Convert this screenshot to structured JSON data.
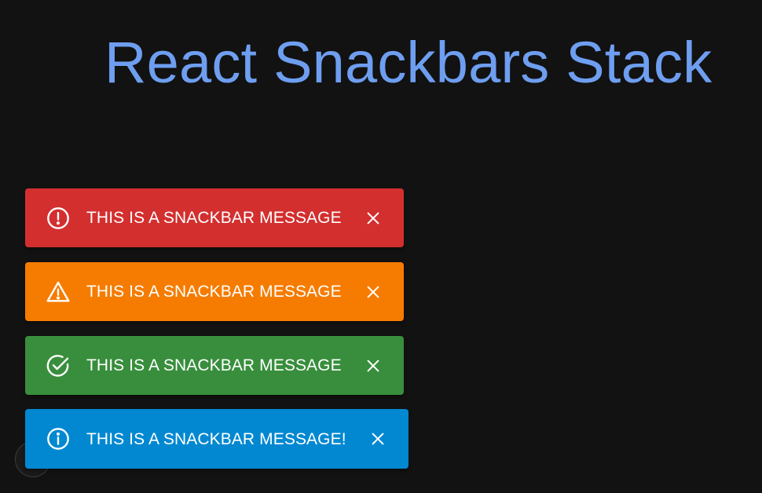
{
  "header": {
    "title": "React Snackbars Stack"
  },
  "colors": {
    "title": "#6e9ef0",
    "background": "#121212",
    "error": "#d32f2f",
    "warning": "#f57c00",
    "success": "#388e3c",
    "info": "#0288d1"
  },
  "snackbars": [
    {
      "variant": "error",
      "icon": "error-outline-icon",
      "message": "THIS IS A SNACKBAR MESSAGE",
      "color": "#d32f2f"
    },
    {
      "variant": "warning",
      "icon": "warning-triangle-icon",
      "message": "THIS IS A SNACKBAR MESSAGE",
      "color": "#f57c00"
    },
    {
      "variant": "success",
      "icon": "check-circle-icon",
      "message": "THIS IS A SNACKBAR MESSAGE",
      "color": "#388e3c"
    },
    {
      "variant": "info",
      "icon": "info-outline-icon",
      "message": "THIS IS A SNACKBAR MESSAGE!",
      "color": "#0288d1"
    }
  ]
}
